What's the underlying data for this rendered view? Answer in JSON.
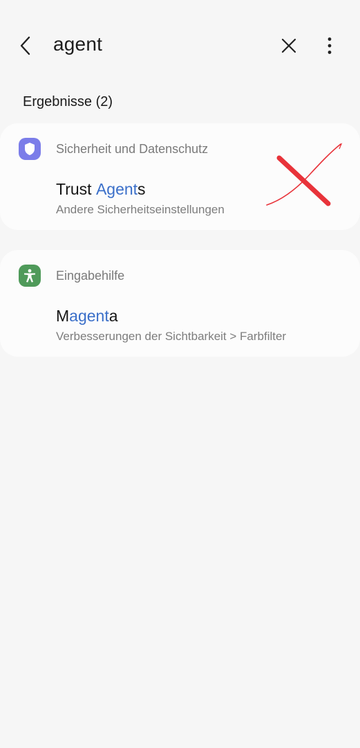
{
  "search": {
    "query": "agent"
  },
  "icons": {
    "back": "chevron-left-icon",
    "clear": "close-icon",
    "more": "more-vertical-icon",
    "security": "shield-icon",
    "accessibility": "accessibility-person-icon"
  },
  "results": {
    "header": "Ergebnisse (2)",
    "groups": [
      {
        "category": "Sicherheit und Datenschutz",
        "icon_color": "#7b7de9",
        "item": {
          "title_pre": "Trust ",
          "title_match": "Agent",
          "title_post": "s",
          "subtitle": "Andere Sicherheitseinstellungen"
        }
      },
      {
        "category": "Eingabehilfe",
        "icon_color": "#4f9a5a",
        "item": {
          "title_pre": "M",
          "title_match": "agent",
          "title_post": "a",
          "subtitle": "Verbesserungen der Sichtbarkeit > Farbfilter"
        }
      }
    ]
  },
  "colors": {
    "highlight": "#3a6fc9",
    "background": "#f6f6f6",
    "card": "#fcfcfc",
    "annotation": "#e8333a"
  }
}
